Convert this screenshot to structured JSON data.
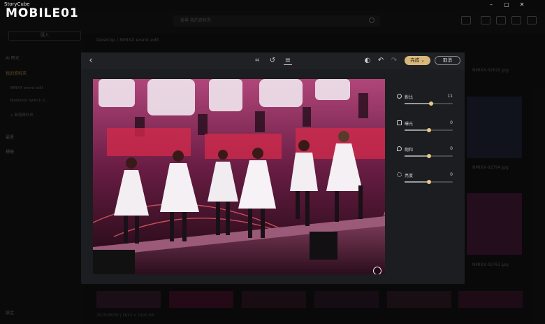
{
  "window": {
    "title": "StoryCube",
    "minimize": "–",
    "maximize": "▢",
    "close": "✕"
  },
  "watermark": "MOBILE01",
  "search": {
    "placeholder": "搜尋 我的資料夾"
  },
  "sidebar": {
    "import_label": "匯入",
    "items": [
      {
        "label": "AI 時光"
      },
      {
        "label": "我的資料夾"
      },
      {
        "label": "NMIXX event edit"
      },
      {
        "label": "Nintendo Switch 2..."
      },
      {
        "label": "+ 新增資料夾"
      },
      {
        "label": "最愛"
      },
      {
        "label": "標籤"
      },
      {
        "label": "設定"
      }
    ]
  },
  "breadcrumb": {
    "root": "Desktop",
    "separator": "/",
    "current": "NMIXX event edit"
  },
  "background_files": [
    {
      "label": "NMIXX-02610.jpg"
    },
    {
      "label": "NMIXX-02794.jpg"
    },
    {
      "label": "NMIXX-02761.jpg"
    }
  ],
  "status_bar": "2025/08/30 | 1613 × 1120 KB",
  "editor": {
    "back_icon": "‹",
    "crop_icon": "⌗",
    "rotate_icon": "↺",
    "adjust_icon": "≡",
    "auto_icon": "◐",
    "undo_icon": "↶",
    "redo_icon": "↷",
    "done_label": "完成",
    "done_arrow": "⌄",
    "cancel_label": "取消",
    "adjustments": [
      {
        "label": "對比",
        "value": "11",
        "level": 0.55,
        "icon": "contrast-icon"
      },
      {
        "label": "曝光",
        "value": "0",
        "level": 0.5,
        "icon": "exposure-icon"
      },
      {
        "label": "飽和",
        "value": "0",
        "level": 0.5,
        "icon": "saturation-icon"
      },
      {
        "label": "亮度",
        "value": "0",
        "level": 0.5,
        "icon": "brightness-icon"
      }
    ]
  },
  "colors": {
    "accent": "#d9b77a",
    "stage_pink": "#8c2a5a",
    "modal_bg": "#1b1d20"
  }
}
